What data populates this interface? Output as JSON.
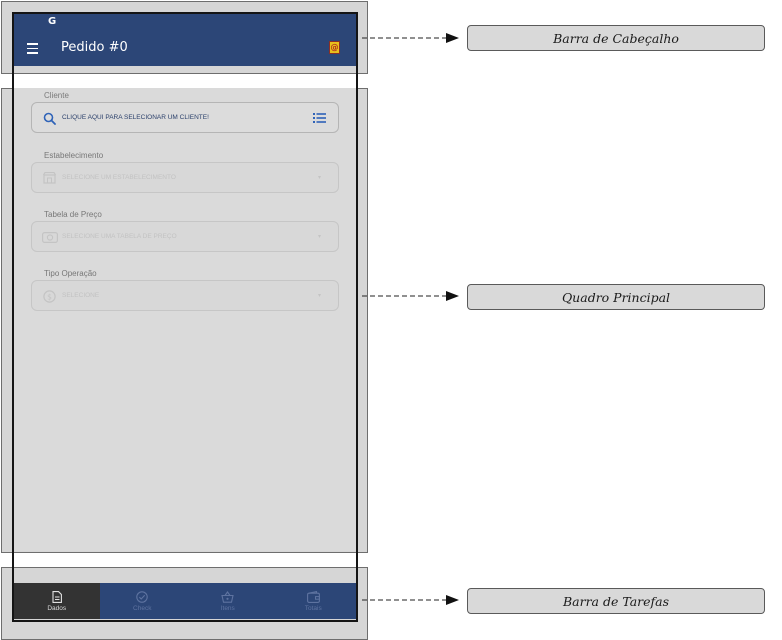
{
  "header": {
    "logo": "G",
    "title": "Pedido #0",
    "avatar_glyph": "@"
  },
  "main": {
    "fields": [
      {
        "label": "Cliente",
        "value": "CLIQUE AQUI PARA SELECIONAR UM CLIENTE!",
        "leading_icon": "search-icon",
        "trailing_icon": "list-icon"
      },
      {
        "label": "Estabelecimento",
        "value": "SELECIONE UM ESTABELECIMENTO",
        "leading_icon": "store-icon",
        "trailing_icon": "caret-down-icon"
      },
      {
        "label": "Tabela de Preço",
        "value": "SELECIONE UMA TABELA DE PREÇO",
        "leading_icon": "money-icon",
        "trailing_icon": "caret-down-icon"
      },
      {
        "label": "Tipo Operação",
        "value": "SELECIONE",
        "leading_icon": "dollar-circle-icon",
        "trailing_icon": "caret-down-icon"
      }
    ]
  },
  "taskbar": {
    "tabs": [
      {
        "label": "Dados",
        "icon": "document-icon",
        "selected": true
      },
      {
        "label": "Check",
        "icon": "check-circle-icon",
        "selected": false
      },
      {
        "label": "Itens",
        "icon": "basket-icon",
        "selected": false
      },
      {
        "label": "Totais",
        "icon": "wallet-icon",
        "selected": false
      }
    ]
  },
  "callouts": {
    "header": "Barra de Cabeçalho",
    "main": "Quadro Principal",
    "taskbar": "Barra de Tarefas"
  },
  "colors": {
    "header_bg": "#2c4677",
    "taskbar_bg": "#2c4677",
    "main_bg": "#dadada",
    "accent_blue": "#2f63b8"
  }
}
